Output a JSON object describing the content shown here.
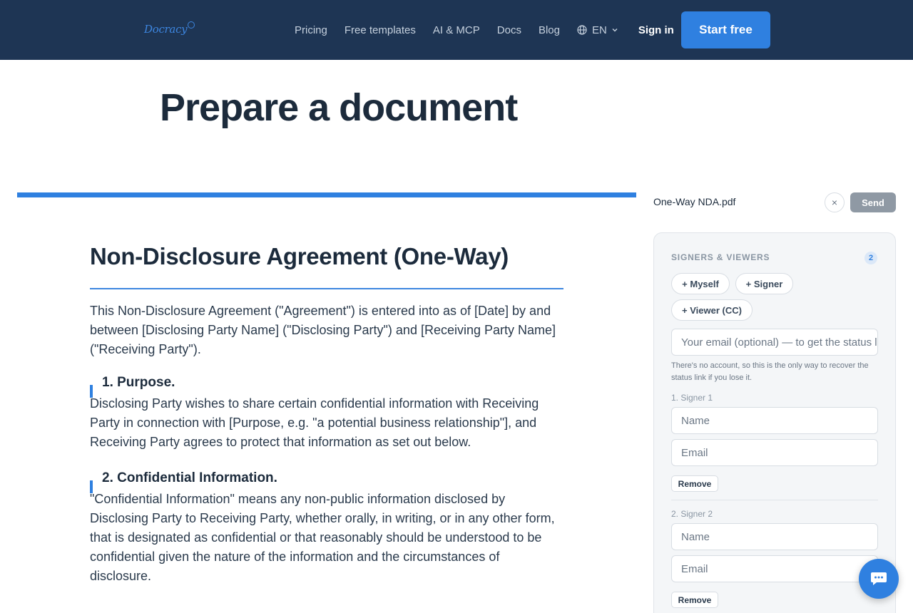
{
  "header": {
    "logo_text": "Docracy",
    "nav": [
      "Pricing",
      "Free templates",
      "AI & MCP",
      "Docs",
      "Blog"
    ],
    "language": "EN",
    "sign_in": "Sign in",
    "start_free": "Start free"
  },
  "page_title": "Prepare a document",
  "document": {
    "title": "Non-Disclosure Agreement (One-Way)",
    "intro": "This Non-Disclosure Agreement (\"Agreement\") is entered into as of [Date] by and between [Disclosing Party Name] (\"Disclosing Party\") and [Receiving Party Name] (\"Receiving Party\").",
    "sections": [
      {
        "heading": "1. Purpose.",
        "body": "Disclosing Party wishes to share certain confidential information with Receiving Party in connection with [Purpose, e.g. \"a potential business relationship\"], and Receiving Party agrees to protect that information as set out below."
      },
      {
        "heading": "2. Confidential Information.",
        "body": "\"Confidential Information\" means any non-public information disclosed by Disclosing Party to Receiving Party, whether orally, in writing, or in any other form, that is designated as confidential or that reasonably should be understood to be confidential given the nature of the information and the circumstances of disclosure."
      }
    ]
  },
  "sidebar": {
    "file_name": "One-Way NDA.pdf",
    "close_symbol": "×",
    "send_label": "Send",
    "section_title": "SIGNERS & VIEWERS",
    "count": "2",
    "add_myself": "+ Myself",
    "add_signer": "+ Signer",
    "add_viewer": "+ Viewer (CC)",
    "email_placeholder": "Your email (optional) — to get the status link",
    "hint": "There's no account, so this is the only way to recover the status link if you lose it.",
    "signers": [
      {
        "label": "1. Signer 1",
        "name_placeholder": "Name",
        "email_placeholder": "Email",
        "remove": "Remove"
      },
      {
        "label": "2. Signer 2",
        "name_placeholder": "Name",
        "email_placeholder": "Email",
        "remove": "Remove"
      }
    ]
  },
  "colors": {
    "header_bg": "#1e3554",
    "accent": "#2f80e0",
    "send_disabled": "#8f99a4"
  },
  "icons": {
    "language": "globe-icon",
    "language_dropdown": "chevron-down-icon",
    "chat": "chat-bubble-icon"
  }
}
